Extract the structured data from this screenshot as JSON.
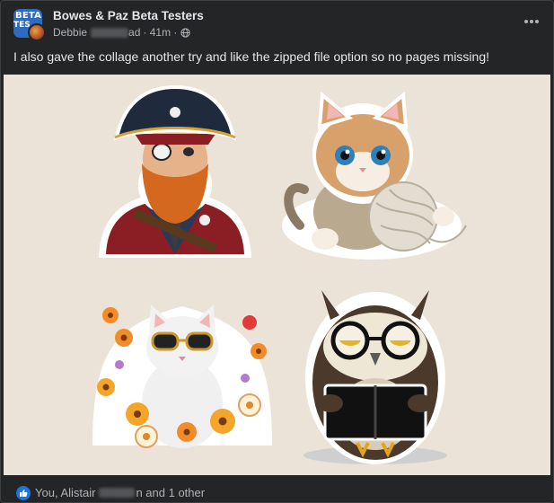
{
  "post": {
    "group_name": "Bowes & Paz Beta Testers",
    "avatar_text_top": "BETA",
    "avatar_text_bottom": "TES",
    "author_first": "Debbie",
    "author_suffix": "ad",
    "time_text": "· 41m ·",
    "audience_icon": "globe-icon",
    "more_icon": "more-options-icon",
    "message": "I also gave the collage another try and like the zipped file option so no pages missing!"
  },
  "image": {
    "background_color": "#ebe3d8",
    "stickers": [
      "pirate",
      "kitten-with-yarn",
      "cat-with-sunglasses-in-flowers",
      "owl-reading-book"
    ]
  },
  "reactions": {
    "icon": "like-icon",
    "prefix": "You, Alistair",
    "suffix": "n and 1 other"
  },
  "colors": {
    "surface": "#242526",
    "text_primary": "#e4e6eb",
    "text_secondary": "#b0b3b8",
    "like_blue": "#1b74e4"
  }
}
